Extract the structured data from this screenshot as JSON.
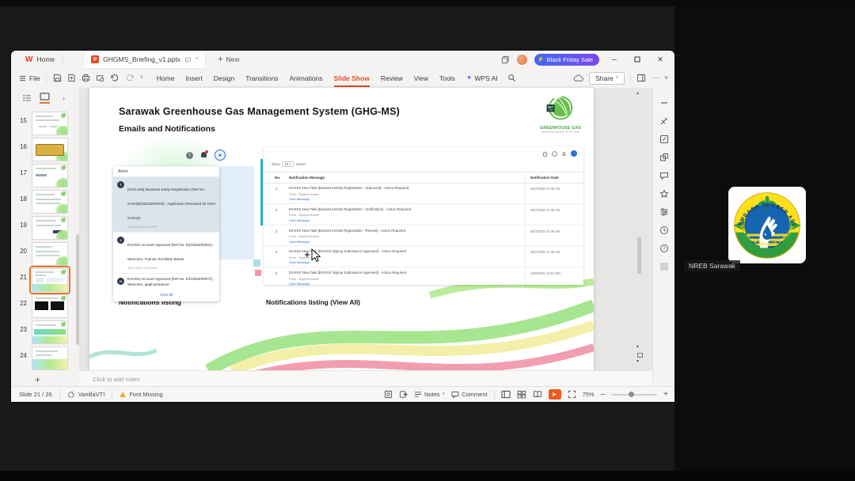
{
  "app": {
    "logo_w": "W",
    "tab_home": "Home",
    "doc_icon_letter": "P",
    "doc_tab": "GHGMS_Briefing_v1.pptx",
    "modified_marker": "*",
    "new_tab": "New",
    "sale_button": "Black Friday Sale",
    "file_menu": "File",
    "menus": [
      "Home",
      "Insert",
      "Design",
      "Transitions",
      "Animations",
      "Slide Show",
      "Review",
      "View",
      "Tools"
    ],
    "active_menu": "Slide Show",
    "wps_ai": "WPS AI",
    "share": "Share"
  },
  "icons": {
    "bolt": "⚡",
    "sparkle": "✦",
    "plus": "+",
    "minimize": "–",
    "close": "✕",
    "more": "⋯",
    "chevron_down": "˅",
    "chevron_right": "›",
    "up_arrow": "▴",
    "down_arrow": "▾",
    "info": "i",
    "question": "?",
    "play": "▶"
  },
  "panel": {
    "slides": [
      "15",
      "16",
      "17",
      "18",
      "19",
      "20",
      "21",
      "22",
      "23",
      "24"
    ],
    "selected": "21"
  },
  "slide": {
    "title": "Sarawak Greenhouse Gas Management System (GHG-MS)",
    "subtitle": "Emails and Notifications",
    "logo_badge_line1": "NET",
    "logo_badge_line2": "2050",
    "logo_line1": "GREENHOUSE GAS",
    "logo_line2": "MANAGEMENT SYSTEM",
    "alerts": {
      "header": "Alerts",
      "items": [
        {
          "avatar": "T",
          "text": "[GHG-MS] Business Entity Registration [Ref No. GHG(BE)/2025/00023] - Application Received for KNN Surveys",
          "time": "21/10/2025 02:19 PM"
        },
        {
          "avatar": "J",
          "text": "EnVISS Account Approved [Ref No. ES/2025/00081] - Welcome, Trainee Sembilan Belas!",
          "time": "30/07/2025 09:09 AM"
        },
        {
          "avatar": "N",
          "text": "EnVISS Account Approved [Ref No. ES/2025/00072] - Welcome, applicantname!",
          "time": ""
        }
      ],
      "view_all": "View all"
    },
    "table": {
      "show": "Show",
      "page_size": "10",
      "entries": "entries",
      "headers": [
        "No.",
        "Notification Message",
        "Notification Date"
      ],
      "rows": [
        {
          "no": "1",
          "msg": "EnVISS New Task [Business Entity Registration - Approved] - Action Required",
          "from": "From : System Admin",
          "link": "View Message",
          "date": "30/7/2025 07:49 AM"
        },
        {
          "no": "2",
          "msg": "EnVISS New Task [Business Entity Registration - Verification] - Action Required",
          "from": "From : System Admin",
          "link": "View Message",
          "date": "30/7/2025 07:48 AM"
        },
        {
          "no": "3",
          "msg": "EnVISS New Task [Business Entity Registration - Review] - Action Required",
          "from": "From : System Admin",
          "link": "View Message",
          "date": "30/7/2025 07:46 AM"
        },
        {
          "no": "4",
          "msg": "EnVISS New Task [EnVISS Signup Submission Approved] - Action Required",
          "from": "From : System Admin",
          "link": "View Message",
          "date": "30/7/2025 07:39 AM"
        },
        {
          "no": "5",
          "msg": "EnVISS New Task [EnVISS Signup Submission Approved] - Action Required",
          "from": "From : System Admin",
          "link": "View Message",
          "date": "18/6/2025 12:01 PM"
        }
      ]
    },
    "caption_left": "Notifications listing",
    "caption_right": "Notifications listing (View All)"
  },
  "notes": {
    "placeholder": "Click to add notes"
  },
  "statusbar": {
    "slide_indicator": "Slide 21 / 26",
    "theme": "VanillaVTI",
    "font_warning": "Font Missing",
    "notes": "Notes",
    "comment": "Comment",
    "zoom": "75%"
  },
  "meeting": {
    "participant": "NREB Sarawak",
    "logo_top": "LEMBAGA SUMBER ASLI",
    "logo_bottom": "DAN ALAM SEKITAR SARAWAK"
  },
  "colors": {
    "accent_orange": "#e8491f",
    "link_blue": "#2f6fd6",
    "sale_start": "#3f6af2",
    "sale_end": "#7e46ee",
    "teal": "#26b3c7"
  }
}
